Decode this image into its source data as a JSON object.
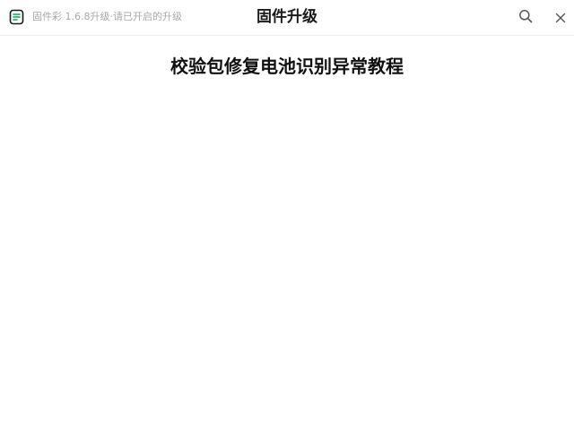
{
  "app": {
    "icon": "document-app-icon",
    "accent_color": "#2bb673",
    "subtitle": "固件彩 1.6.8升级·请已开启的升级",
    "title": "固件升级"
  },
  "toolbar": {
    "search_icon": "search-icon",
    "close_icon": "close-icon"
  },
  "document": {
    "heading": "校验包修复电池识别异常教程"
  }
}
